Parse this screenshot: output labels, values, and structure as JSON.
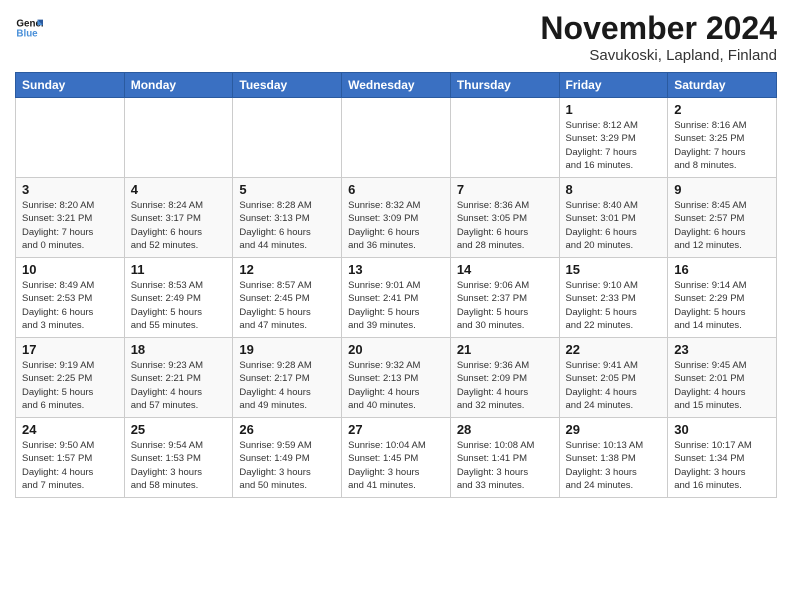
{
  "logo": {
    "text_general": "General",
    "text_blue": "Blue"
  },
  "title": "November 2024",
  "subtitle": "Savukoski, Lapland, Finland",
  "days_of_week": [
    "Sunday",
    "Monday",
    "Tuesday",
    "Wednesday",
    "Thursday",
    "Friday",
    "Saturday"
  ],
  "weeks": [
    [
      {
        "day": "",
        "info": ""
      },
      {
        "day": "",
        "info": ""
      },
      {
        "day": "",
        "info": ""
      },
      {
        "day": "",
        "info": ""
      },
      {
        "day": "",
        "info": ""
      },
      {
        "day": "1",
        "info": "Sunrise: 8:12 AM\nSunset: 3:29 PM\nDaylight: 7 hours\nand 16 minutes."
      },
      {
        "day": "2",
        "info": "Sunrise: 8:16 AM\nSunset: 3:25 PM\nDaylight: 7 hours\nand 8 minutes."
      }
    ],
    [
      {
        "day": "3",
        "info": "Sunrise: 8:20 AM\nSunset: 3:21 PM\nDaylight: 7 hours\nand 0 minutes."
      },
      {
        "day": "4",
        "info": "Sunrise: 8:24 AM\nSunset: 3:17 PM\nDaylight: 6 hours\nand 52 minutes."
      },
      {
        "day": "5",
        "info": "Sunrise: 8:28 AM\nSunset: 3:13 PM\nDaylight: 6 hours\nand 44 minutes."
      },
      {
        "day": "6",
        "info": "Sunrise: 8:32 AM\nSunset: 3:09 PM\nDaylight: 6 hours\nand 36 minutes."
      },
      {
        "day": "7",
        "info": "Sunrise: 8:36 AM\nSunset: 3:05 PM\nDaylight: 6 hours\nand 28 minutes."
      },
      {
        "day": "8",
        "info": "Sunrise: 8:40 AM\nSunset: 3:01 PM\nDaylight: 6 hours\nand 20 minutes."
      },
      {
        "day": "9",
        "info": "Sunrise: 8:45 AM\nSunset: 2:57 PM\nDaylight: 6 hours\nand 12 minutes."
      }
    ],
    [
      {
        "day": "10",
        "info": "Sunrise: 8:49 AM\nSunset: 2:53 PM\nDaylight: 6 hours\nand 3 minutes."
      },
      {
        "day": "11",
        "info": "Sunrise: 8:53 AM\nSunset: 2:49 PM\nDaylight: 5 hours\nand 55 minutes."
      },
      {
        "day": "12",
        "info": "Sunrise: 8:57 AM\nSunset: 2:45 PM\nDaylight: 5 hours\nand 47 minutes."
      },
      {
        "day": "13",
        "info": "Sunrise: 9:01 AM\nSunset: 2:41 PM\nDaylight: 5 hours\nand 39 minutes."
      },
      {
        "day": "14",
        "info": "Sunrise: 9:06 AM\nSunset: 2:37 PM\nDaylight: 5 hours\nand 30 minutes."
      },
      {
        "day": "15",
        "info": "Sunrise: 9:10 AM\nSunset: 2:33 PM\nDaylight: 5 hours\nand 22 minutes."
      },
      {
        "day": "16",
        "info": "Sunrise: 9:14 AM\nSunset: 2:29 PM\nDaylight: 5 hours\nand 14 minutes."
      }
    ],
    [
      {
        "day": "17",
        "info": "Sunrise: 9:19 AM\nSunset: 2:25 PM\nDaylight: 5 hours\nand 6 minutes."
      },
      {
        "day": "18",
        "info": "Sunrise: 9:23 AM\nSunset: 2:21 PM\nDaylight: 4 hours\nand 57 minutes."
      },
      {
        "day": "19",
        "info": "Sunrise: 9:28 AM\nSunset: 2:17 PM\nDaylight: 4 hours\nand 49 minutes."
      },
      {
        "day": "20",
        "info": "Sunrise: 9:32 AM\nSunset: 2:13 PM\nDaylight: 4 hours\nand 40 minutes."
      },
      {
        "day": "21",
        "info": "Sunrise: 9:36 AM\nSunset: 2:09 PM\nDaylight: 4 hours\nand 32 minutes."
      },
      {
        "day": "22",
        "info": "Sunrise: 9:41 AM\nSunset: 2:05 PM\nDaylight: 4 hours\nand 24 minutes."
      },
      {
        "day": "23",
        "info": "Sunrise: 9:45 AM\nSunset: 2:01 PM\nDaylight: 4 hours\nand 15 minutes."
      }
    ],
    [
      {
        "day": "24",
        "info": "Sunrise: 9:50 AM\nSunset: 1:57 PM\nDaylight: 4 hours\nand 7 minutes."
      },
      {
        "day": "25",
        "info": "Sunrise: 9:54 AM\nSunset: 1:53 PM\nDaylight: 3 hours\nand 58 minutes."
      },
      {
        "day": "26",
        "info": "Sunrise: 9:59 AM\nSunset: 1:49 PM\nDaylight: 3 hours\nand 50 minutes."
      },
      {
        "day": "27",
        "info": "Sunrise: 10:04 AM\nSunset: 1:45 PM\nDaylight: 3 hours\nand 41 minutes."
      },
      {
        "day": "28",
        "info": "Sunrise: 10:08 AM\nSunset: 1:41 PM\nDaylight: 3 hours\nand 33 minutes."
      },
      {
        "day": "29",
        "info": "Sunrise: 10:13 AM\nSunset: 1:38 PM\nDaylight: 3 hours\nand 24 minutes."
      },
      {
        "day": "30",
        "info": "Sunrise: 10:17 AM\nSunset: 1:34 PM\nDaylight: 3 hours\nand 16 minutes."
      }
    ]
  ]
}
